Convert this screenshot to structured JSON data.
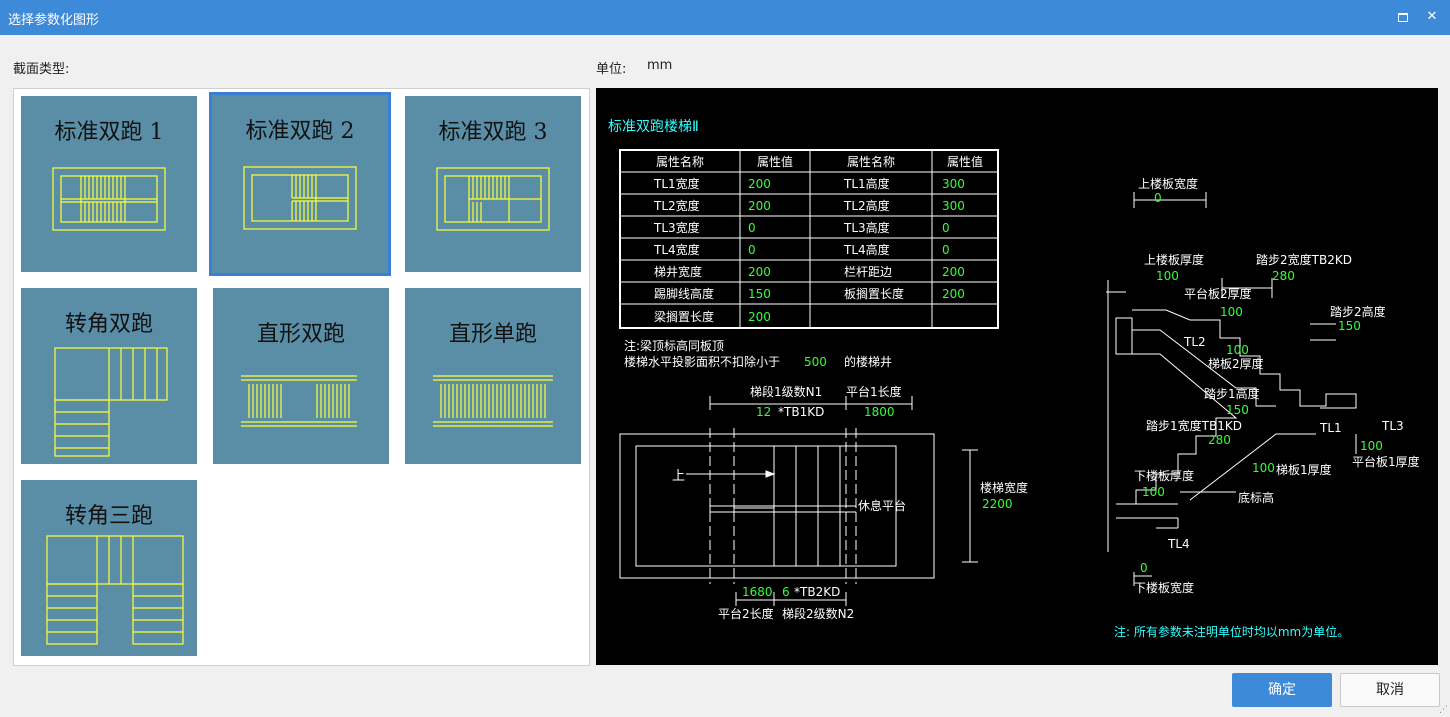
{
  "window": {
    "title": "选择参数化图形",
    "maximize_icon": "maximize-icon",
    "close_glyph": "✕"
  },
  "section_label": "截面类型:",
  "unit_label": "单位:",
  "unit_value": "mm",
  "tiles": [
    {
      "label": "标准双跑 1",
      "selected": false
    },
    {
      "label": "标准双跑 2",
      "selected": true
    },
    {
      "label": "标准双跑 3",
      "selected": false
    },
    {
      "label": "转角双跑",
      "selected": false
    },
    {
      "label": "直形双跑",
      "selected": false
    },
    {
      "label": "直形单跑",
      "selected": false
    },
    {
      "label": "转角三跑",
      "selected": false
    }
  ],
  "preview": {
    "title": "标准双跑楼梯Ⅱ",
    "table_header": [
      "属性名称",
      "属性值",
      "属性名称",
      "属性值"
    ],
    "table_rows": [
      [
        "TL1宽度",
        "200",
        "TL1高度",
        "300"
      ],
      [
        "TL2宽度",
        "200",
        "TL2高度",
        "300"
      ],
      [
        "TL3宽度",
        "0",
        "TL3高度",
        "0"
      ],
      [
        "TL4宽度",
        "0",
        "TL4高度",
        "0"
      ],
      [
        "梯井宽度",
        "200",
        "栏杆距边",
        "200"
      ],
      [
        "踢脚线高度",
        "150",
        "板搁置长度",
        "200"
      ],
      [
        "梁搁置长度",
        "200",
        "",
        ""
      ]
    ],
    "note_line1": "注:梁顶标高同板顶",
    "note_line2_a": "楼梯水平投影面积不扣除小于",
    "note_line2_value": "500",
    "note_line2_b": "的楼梯井",
    "plan": {
      "run1_label": "梯段1级数N1",
      "run1_value": "12",
      "run1_suffix": "*TB1KD",
      "landing1_label": "平台1长度",
      "landing1_value": "1800",
      "up_label": "上",
      "rest_label": "休息平台",
      "width_label": "楼梯宽度",
      "width_value": "2200",
      "landing2_value": "1680",
      "run2_value": "6",
      "run2_suffix": "*TB2KD",
      "landing2_label": "平台2长度",
      "run2_label": "梯段2级数N2"
    },
    "section": {
      "upper_slab_width_label": "上楼板宽度",
      "upper_slab_width_value": "0",
      "upper_slab_thick_label": "上楼板厚度",
      "upper_slab_thick_value": "100",
      "step2_width_label": "踏步2宽度TB2KD",
      "step2_width_value": "280",
      "platform2_thick_label": "平台板2厚度",
      "platform2_thick_value": "100",
      "step2_height_label": "踏步2高度",
      "step2_height_value": "150",
      "tl2": "TL2",
      "slab2_thick_value": "100",
      "slab2_thick_label": "梯板2厚度",
      "step1_height_label": "踏步1高度",
      "step1_height_value": "150",
      "step1_width_label": "踏步1宽度TB1KD",
      "step1_width_value": "280",
      "tl1": "TL1",
      "tl3": "TL3",
      "platform1_thick_value": "100",
      "platform1_thick_label": "平台板1厚度",
      "slab1_thick_value": "100",
      "slab1_thick_label": "梯板1厚度",
      "lower_slab_thick_label": "下楼板厚度",
      "lower_slab_thick_value": "100",
      "bottom_elev_label": "底标高",
      "tl4": "TL4",
      "lower_slab_width_value": "0",
      "lower_slab_width_label": "下楼板宽度"
    },
    "footer_note": "注: 所有参数未注明单位时均以mm为单位。"
  },
  "buttons": {
    "ok": "确定",
    "cancel": "取消"
  },
  "colors": {
    "accent": "#3d8ad8",
    "tile_bg": "#5a8ea7",
    "cad_yellow": "#ffff33",
    "cad_green": "#33ff33",
    "cad_cyan": "#33ffff"
  }
}
